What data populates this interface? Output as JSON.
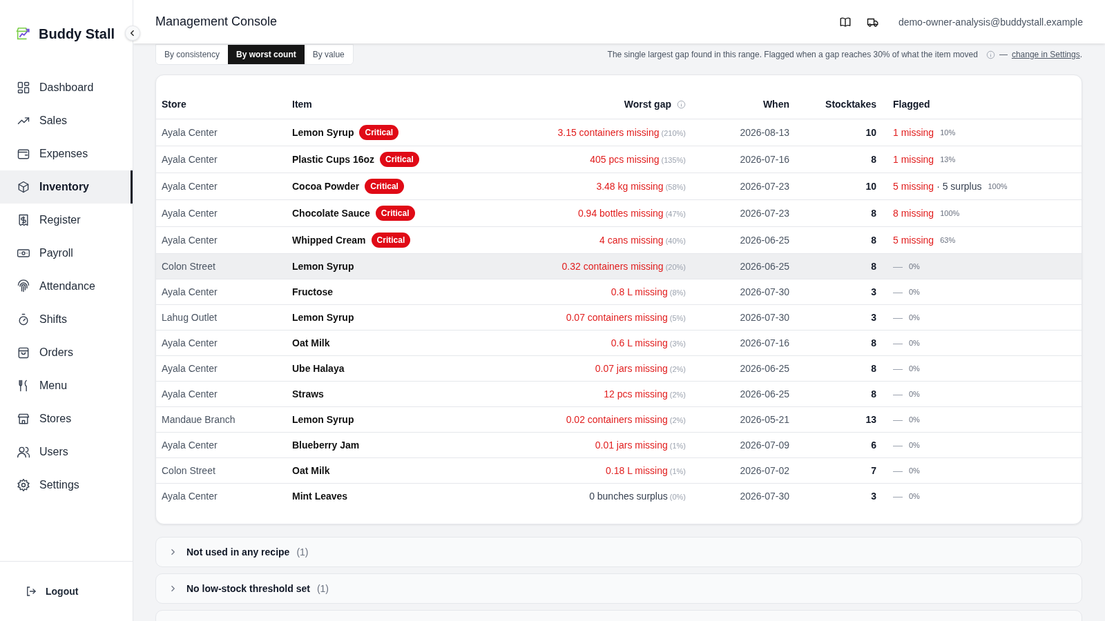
{
  "sidebar": {
    "brand": "Buddy Stall",
    "items": [
      {
        "label": "Dashboard",
        "selected": false
      },
      {
        "label": "Sales",
        "selected": false
      },
      {
        "label": "Expenses",
        "selected": false
      },
      {
        "label": "Inventory",
        "selected": true
      },
      {
        "label": "Register",
        "selected": false
      },
      {
        "label": "Payroll",
        "selected": false
      },
      {
        "label": "Attendance",
        "selected": false
      },
      {
        "label": "Shifts",
        "selected": false
      },
      {
        "label": "Orders",
        "selected": false
      },
      {
        "label": "Menu",
        "selected": false
      },
      {
        "label": "Stores",
        "selected": false
      },
      {
        "label": "Users",
        "selected": false
      },
      {
        "label": "Settings",
        "selected": false
      }
    ],
    "logout": "Logout"
  },
  "header": {
    "title": "Management Console",
    "user": "demo-owner-analysis@buddystall.example"
  },
  "view_tabs": [
    {
      "label": "By consistency",
      "selected": false
    },
    {
      "label": "By worst count",
      "selected": true
    },
    {
      "label": "By value",
      "selected": false
    }
  ],
  "hint": {
    "text": "The single largest gap found in this range. Flagged when a gap reaches 30% of what the item moved",
    "dash": "—",
    "link": "change in Settings",
    "end": "."
  },
  "table": {
    "columns": [
      "Store",
      "Item",
      "Worst gap",
      "When",
      "Stocktakes",
      "Flagged"
    ],
    "rows": [
      {
        "store": "Ayala Center",
        "item": "Lemon Syrup",
        "badge": "Critical",
        "gap": "3.15 containers missing",
        "kind": "missing",
        "gap_pct": "(210%)",
        "when": "2026-08-13",
        "stocktakes": "10",
        "flag_missing": "1 missing",
        "flag_pct": "10%",
        "highlighted": false
      },
      {
        "store": "Ayala Center",
        "item": "Plastic Cups 16oz",
        "badge": "Critical",
        "gap": "405 pcs missing",
        "kind": "missing",
        "gap_pct": "(135%)",
        "when": "2026-07-16",
        "stocktakes": "8",
        "flag_missing": "1 missing",
        "flag_pct": "13%",
        "highlighted": false
      },
      {
        "store": "Ayala Center",
        "item": "Cocoa Powder",
        "badge": "Critical",
        "gap": "3.48 kg missing",
        "kind": "missing",
        "gap_pct": "(58%)",
        "when": "2026-07-23",
        "stocktakes": "10",
        "flag_missing": "5 missing",
        "flag_surplus": "· 5 surplus",
        "flag_pct": "100%",
        "highlighted": false
      },
      {
        "store": "Ayala Center",
        "item": "Chocolate Sauce",
        "badge": "Critical",
        "gap": "0.94 bottles missing",
        "kind": "missing",
        "gap_pct": "(47%)",
        "when": "2026-07-23",
        "stocktakes": "8",
        "flag_missing": "8 missing",
        "flag_pct": "100%",
        "highlighted": false
      },
      {
        "store": "Ayala Center",
        "item": "Whipped Cream",
        "badge": "Critical",
        "gap": "4 cans missing",
        "kind": "missing",
        "gap_pct": "(40%)",
        "when": "2026-06-25",
        "stocktakes": "8",
        "flag_missing": "5 missing",
        "flag_pct": "63%",
        "highlighted": false
      },
      {
        "store": "Colon Street",
        "item": "Lemon Syrup",
        "gap": "0.32 containers missing",
        "kind": "missing",
        "gap_pct": "(20%)",
        "when": "2026-06-25",
        "stocktakes": "8",
        "flag_dash": "—",
        "flag_pct": "0%",
        "highlighted": true
      },
      {
        "store": "Ayala Center",
        "item": "Fructose",
        "gap": "0.8 L missing",
        "kind": "missing",
        "gap_pct": "(8%)",
        "when": "2026-07-30",
        "stocktakes": "3",
        "flag_dash": "—",
        "flag_pct": "0%",
        "highlighted": false
      },
      {
        "store": "Lahug Outlet",
        "item": "Lemon Syrup",
        "gap": "0.07 containers missing",
        "kind": "missing",
        "gap_pct": "(5%)",
        "when": "2026-07-30",
        "stocktakes": "3",
        "flag_dash": "—",
        "flag_pct": "0%",
        "highlighted": false
      },
      {
        "store": "Ayala Center",
        "item": "Oat Milk",
        "gap": "0.6 L missing",
        "kind": "missing",
        "gap_pct": "(3%)",
        "when": "2026-07-16",
        "stocktakes": "8",
        "flag_dash": "—",
        "flag_pct": "0%",
        "highlighted": false
      },
      {
        "store": "Ayala Center",
        "item": "Ube Halaya",
        "gap": "0.07 jars missing",
        "kind": "missing",
        "gap_pct": "(2%)",
        "when": "2026-06-25",
        "stocktakes": "8",
        "flag_dash": "—",
        "flag_pct": "0%",
        "highlighted": false
      },
      {
        "store": "Ayala Center",
        "item": "Straws",
        "gap": "12 pcs missing",
        "kind": "missing",
        "gap_pct": "(2%)",
        "when": "2026-06-25",
        "stocktakes": "8",
        "flag_dash": "—",
        "flag_pct": "0%",
        "highlighted": false
      },
      {
        "store": "Mandaue Branch",
        "item": "Lemon Syrup",
        "gap": "0.02 containers missing",
        "kind": "missing",
        "gap_pct": "(2%)",
        "when": "2026-05-21",
        "stocktakes": "13",
        "flag_dash": "—",
        "flag_pct": "0%",
        "highlighted": false
      },
      {
        "store": "Ayala Center",
        "item": "Blueberry Jam",
        "gap": "0.01 jars missing",
        "kind": "missing",
        "gap_pct": "(1%)",
        "when": "2026-07-09",
        "stocktakes": "6",
        "flag_dash": "—",
        "flag_pct": "0%",
        "highlighted": false
      },
      {
        "store": "Colon Street",
        "item": "Oat Milk",
        "gap": "0.18 L missing",
        "kind": "missing",
        "gap_pct": "(1%)",
        "when": "2026-07-02",
        "stocktakes": "7",
        "flag_dash": "—",
        "flag_pct": "0%",
        "highlighted": false
      },
      {
        "store": "Ayala Center",
        "item": "Mint Leaves",
        "gap": "0 bunches surplus",
        "kind": "surplus",
        "gap_pct": "(0%)",
        "when": "2026-07-30",
        "stocktakes": "3",
        "flag_dash": "—",
        "flag_pct": "0%",
        "highlighted": false
      }
    ]
  },
  "sections": [
    {
      "title": "Not used in any recipe",
      "count": "(1)",
      "expanded": false
    },
    {
      "title": "No low-stock threshold set",
      "count": "(1)",
      "expanded": false
    }
  ]
}
